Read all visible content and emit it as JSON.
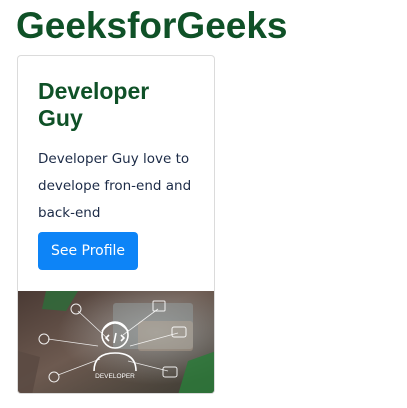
{
  "header": {
    "title": "GeeksforGeeks"
  },
  "card": {
    "title": "Developer Guy",
    "text": "Developer Guy love to develope fron-end and back-end",
    "button_label": "See Profile",
    "image_caption": "DEVELOPER"
  },
  "colors": {
    "brand_green": "#0f5127",
    "button_blue": "#0d84f7",
    "body_text": "#1c2b47"
  }
}
